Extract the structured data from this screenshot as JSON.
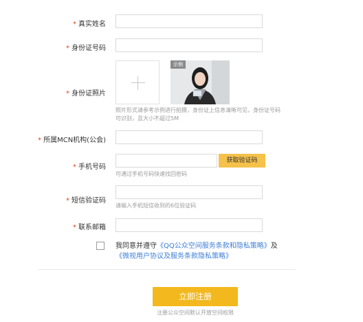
{
  "required_mark": "*",
  "fields": {
    "real_name": {
      "label": "真实姓名"
    },
    "id_number": {
      "label": "身份证号码"
    },
    "id_photo": {
      "label": "身份证照片",
      "sample_tag": "示例",
      "hint_line1": "照片形式请参考示例进行拍摄，身份证上信息清晰可见，身份证号码",
      "hint_line2": "可识别，且大小不超过5M"
    },
    "mcn": {
      "label": "所属MCN机构(公会)"
    },
    "phone": {
      "label": "手机号码",
      "hint": "可通过手机号码快速找回密码",
      "code_button": "获取验证码"
    },
    "sms_code": {
      "label": "短信验证码",
      "hint": "请输入手机短信收到的6位验证码"
    },
    "email": {
      "label": "联系邮箱"
    }
  },
  "agreement": {
    "prefix": "我同意并遵守",
    "link1": "《QQ公众空间服务条款和隐私策略》",
    "joiner": "及",
    "link2": "《微视用户协议及服务条款隐私策略》"
  },
  "submit_label": "立即注册",
  "footnote": "注册公众空间默认开放空间权限",
  "colors": {
    "required": "#e0401a",
    "link": "#3f7fd6",
    "code_button_bg": "#f5c14a",
    "submit_bg": "#f2b81d"
  },
  "icons": {
    "upload": "plus-icon"
  }
}
